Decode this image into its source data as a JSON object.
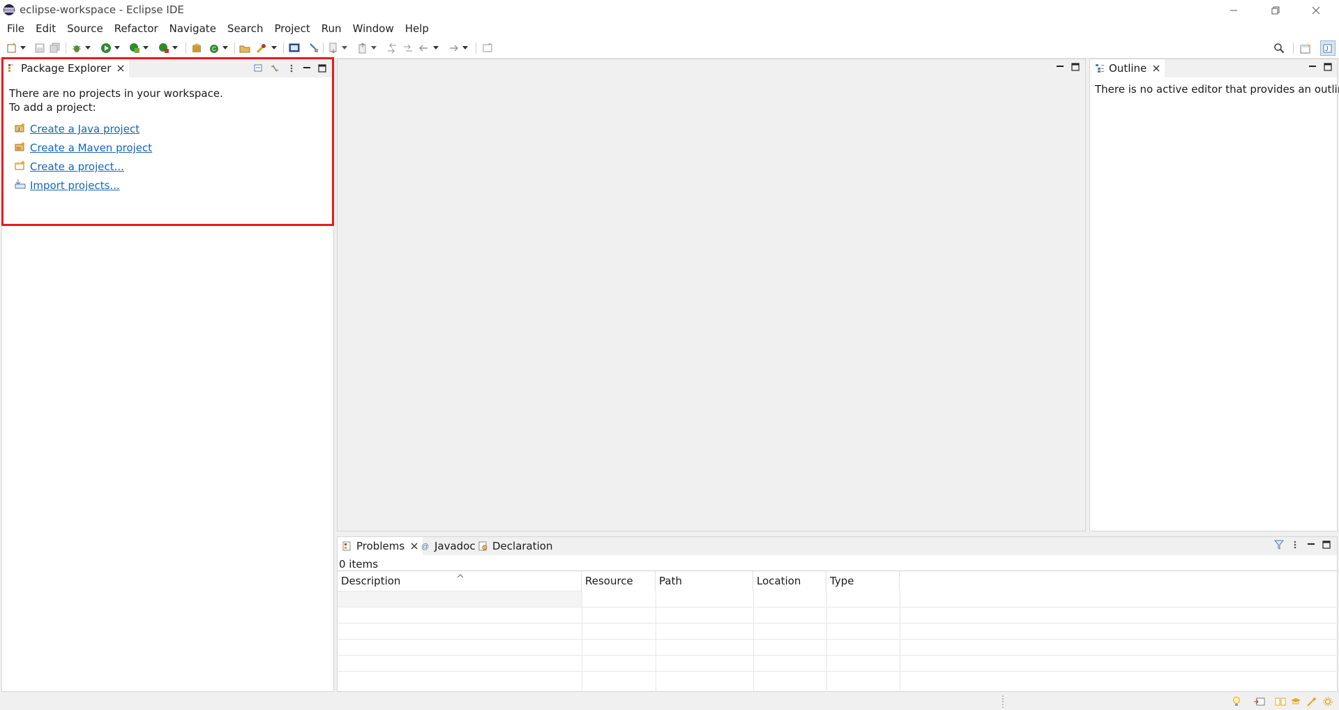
{
  "window": {
    "title": "eclipse-workspace - Eclipse IDE",
    "logo_icon": "eclipse-logo-icon",
    "controls": [
      "minimize-icon",
      "restore-icon",
      "close-icon"
    ]
  },
  "menu": [
    "File",
    "Edit",
    "Source",
    "Refactor",
    "Navigate",
    "Search",
    "Project",
    "Run",
    "Window",
    "Help"
  ],
  "toolbar": {
    "icons": [
      "new-icon",
      "save-icon",
      "save-all-icon",
      "debug-icon",
      "run-icon",
      "coverage-icon",
      "external-tools-icon",
      "new-java-package-icon",
      "new-java-class-icon",
      "open-type-icon",
      "search-icon",
      "terminal-icon",
      "toggle-mark-occurrences-icon",
      "next-annotation-icon",
      "previous-annotation-icon",
      "last-edit-location-icon",
      "back-icon",
      "forward-icon",
      "pin-editor-icon"
    ],
    "right_icons": [
      "search-icon",
      "open-perspective-icon",
      "java-perspective-icon"
    ]
  },
  "package_explorer": {
    "tab_label": "Package Explorer",
    "message_line1": "There are no projects in your workspace.",
    "message_line2": "To add a project:",
    "links": [
      {
        "label": "Create a Java project",
        "icon": "new-java-project-icon"
      },
      {
        "label": "Create a Maven project",
        "icon": "new-maven-project-icon"
      },
      {
        "label": "Create a project...",
        "icon": "new-project-icon"
      },
      {
        "label": "Import projects...",
        "icon": "import-icon"
      }
    ],
    "highlight_color": "#e81c1c"
  },
  "outline": {
    "tab_label": "Outline",
    "message": "There is no active editor that provides an outline."
  },
  "bottom_panel": {
    "tabs": [
      {
        "label": "Problems",
        "icon": "problems-icon",
        "active": true
      },
      {
        "label": "Javadoc",
        "icon": "javadoc-icon",
        "active": false
      },
      {
        "label": "Declaration",
        "icon": "declaration-icon",
        "active": false
      }
    ],
    "items_count": "0 items",
    "columns": [
      "Description",
      "Resource",
      "Path",
      "Location",
      "Type"
    ]
  },
  "colors": {
    "link": "#1565c0",
    "highlight": "#e81c1c",
    "panel_bg": "#ffffff",
    "chrome_bg": "#f0f0f0"
  }
}
